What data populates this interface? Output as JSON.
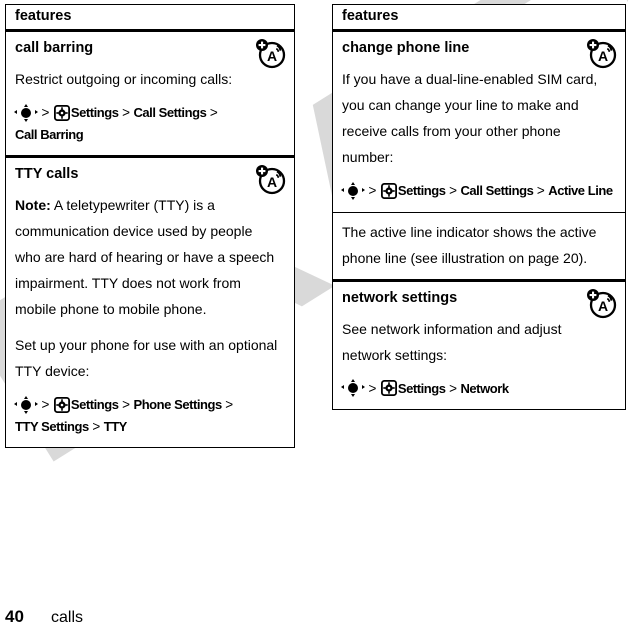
{
  "document": {
    "footer": {
      "page_number": "40",
      "chapter": "calls"
    },
    "watermark": "DRAFT"
  },
  "columns": [
    {
      "header": "features",
      "rows": [
        {
          "title": "call barring",
          "icon": "network-roaming-icon",
          "blocks": [
            {
              "type": "text",
              "text": "Restrict outgoing or incoming calls:"
            },
            {
              "type": "path",
              "items": [
                "nav-key-icon",
                "gear-icon",
                "Settings",
                "Call Settings",
                "Call Barring"
              ]
            }
          ]
        },
        {
          "title": "TTY calls",
          "icon": "network-roaming-icon",
          "blocks": [
            {
              "type": "text",
              "bold_prefix": "Note:",
              "text": " A teletypewriter (TTY) is a communication device used by people who are hard of hearing or have a speech impairment. TTY does not work from mobile phone to mobile phone."
            },
            {
              "type": "text",
              "text": "Set up your phone for use with an optional TTY device:"
            },
            {
              "type": "path",
              "items": [
                "nav-key-icon",
                "gear-icon",
                "Settings",
                "Phone Settings",
                "TTY Settings",
                "TTY"
              ]
            }
          ]
        }
      ]
    },
    {
      "header": "features",
      "rows": [
        {
          "title": "change phone line",
          "icon": "network-roaming-icon",
          "blocks": [
            {
              "type": "text",
              "text": "If you have a dual-line-enabled SIM card, you can change your line to make and receive calls from your other phone number:"
            },
            {
              "type": "path",
              "items": [
                "nav-key-icon",
                "gear-icon",
                "Settings",
                "Call Settings",
                "Active Line"
              ]
            }
          ]
        },
        {
          "title": "",
          "icon": "",
          "subrow": true,
          "blocks": [
            {
              "type": "text",
              "text": "The active line indicator shows the active phone line (see illustration on page 20)."
            }
          ]
        },
        {
          "title": "network settings",
          "icon": "network-roaming-icon",
          "blocks": [
            {
              "type": "text",
              "text": "See network information and adjust network settings:"
            },
            {
              "type": "path",
              "items": [
                "nav-key-icon",
                "gear-icon",
                "Settings",
                "Network"
              ]
            }
          ]
        }
      ]
    }
  ],
  "path_separator": ">",
  "colors": {
    "text": "#000000",
    "background": "#ffffff",
    "watermark": "#d9d9d9",
    "rule": "#000000"
  }
}
